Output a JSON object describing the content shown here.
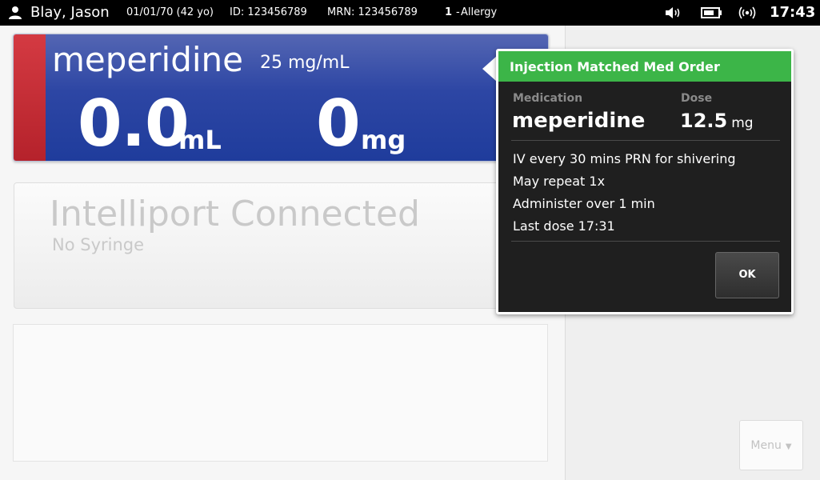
{
  "topbar": {
    "patient_name": "Blay, Jason",
    "dob": "01/01/70 (42 yo)",
    "id": "ID: 123456789",
    "mrn": "MRN: 123456789",
    "allergy_count": "1",
    "allergy_sep": "-",
    "allergy_label": "Allergy",
    "time": "17:43",
    "icons": [
      "person-icon",
      "speaker-icon",
      "battery-icon",
      "wireless-signal-icon"
    ]
  },
  "drug_card": {
    "name": "meperidine",
    "concentration": "25 mg/mL",
    "volume_value": "0.0",
    "volume_unit": "mL",
    "mg_value": "0",
    "mg_unit": "mg",
    "colors": {
      "stripe": "#c42a33",
      "body": "#2d46a4"
    }
  },
  "intelliport": {
    "title": "Intelliport Connected",
    "subtitle": "No Syringe"
  },
  "popup": {
    "header": "Injection Matched Med Order",
    "medication_label": "Medication",
    "dose_label": "Dose",
    "medication": "meperidine",
    "dose_value": "12.5",
    "dose_unit": "mg",
    "instructions": [
      "IV every 30 mins PRN for shivering",
      "May repeat 1x",
      "Administer over 1 min",
      "Last dose 17:31"
    ],
    "ok_label": "OK",
    "colors": {
      "header": "#3cb548",
      "background": "#1f1f1f"
    }
  },
  "menu": {
    "label": "Menu"
  }
}
